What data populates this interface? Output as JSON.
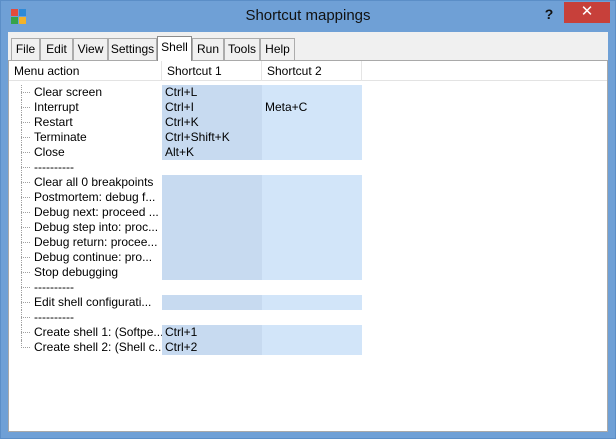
{
  "window": {
    "title": "Shortcut mappings",
    "help_label": "?",
    "close_label": "✕",
    "app_icon_colors": [
      "#e34b3c",
      "#2e8ad8",
      "#36a34a",
      "#f3b229"
    ]
  },
  "tabs": [
    {
      "label": "File"
    },
    {
      "label": "Edit"
    },
    {
      "label": "View"
    },
    {
      "label": "Settings"
    },
    {
      "label": "Shell",
      "active": true
    },
    {
      "label": "Run"
    },
    {
      "label": "Tools"
    },
    {
      "label": "Help"
    }
  ],
  "table": {
    "headers": [
      "Menu action",
      "Shortcut 1",
      "Shortcut 2"
    ],
    "rows": [
      {
        "label": "Clear screen",
        "s1": "Ctrl+L",
        "s2": ""
      },
      {
        "label": "Interrupt",
        "s1": "Ctrl+I",
        "s2": "Meta+C"
      },
      {
        "label": "Restart",
        "s1": "Ctrl+K",
        "s2": ""
      },
      {
        "label": "Terminate",
        "s1": "Ctrl+Shift+K",
        "s2": ""
      },
      {
        "label": "Close",
        "s1": "Alt+K",
        "s2": ""
      },
      {
        "label": "----------",
        "separator": true
      },
      {
        "label": "Clear all 0 breakpoints",
        "s1": "",
        "s2": ""
      },
      {
        "label": "Postmortem: debug f...",
        "s1": "",
        "s2": ""
      },
      {
        "label": "Debug next: proceed ...",
        "s1": "",
        "s2": ""
      },
      {
        "label": "Debug step into: proc...",
        "s1": "",
        "s2": ""
      },
      {
        "label": "Debug return: procee...",
        "s1": "",
        "s2": ""
      },
      {
        "label": "Debug continue: pro...",
        "s1": "",
        "s2": ""
      },
      {
        "label": "Stop debugging",
        "s1": "",
        "s2": ""
      },
      {
        "label": "----------",
        "separator": true
      },
      {
        "label": "Edit shell configurati...",
        "s1": "",
        "s2": ""
      },
      {
        "label": "----------",
        "separator": true
      },
      {
        "label": "Create shell 1: (Softpe...",
        "s1": "Ctrl+1",
        "s2": ""
      },
      {
        "label": "Create shell 2: (Shell c...",
        "s1": "Ctrl+2",
        "s2": ""
      }
    ]
  }
}
